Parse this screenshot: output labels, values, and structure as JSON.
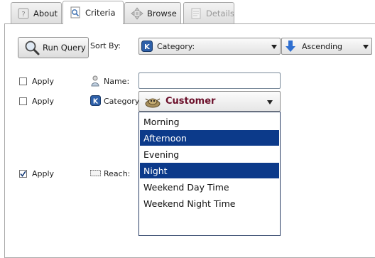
{
  "tabs": [
    {
      "label": "About",
      "icon": "about-icon",
      "state": "normal"
    },
    {
      "label": "Criteria",
      "icon": "criteria-icon",
      "state": "active"
    },
    {
      "label": "Browse",
      "icon": "browse-icon",
      "state": "normal"
    },
    {
      "label": "Details",
      "icon": "details-icon",
      "state": "disabled"
    }
  ],
  "toolbar": {
    "run_query_label": "Run Query",
    "sort_by_label": "Sort By:",
    "sort_field_value": "Category:",
    "sort_order_value": "Ascending"
  },
  "criteria": {
    "name_row": {
      "apply_label": "Apply",
      "apply_checked": false,
      "field_label": "Name:",
      "value": ""
    },
    "category_row": {
      "apply_label": "Apply",
      "apply_checked": false,
      "field_label": "Category:",
      "value": "Customer"
    },
    "reach_row": {
      "apply_label": "Apply",
      "apply_checked": true,
      "field_label": "Reach:"
    }
  },
  "category_dropdown": {
    "options": [
      {
        "label": "Morning",
        "selected": false
      },
      {
        "label": "Afternoon",
        "selected": true
      },
      {
        "label": "Evening",
        "selected": false
      },
      {
        "label": "Night",
        "selected": true
      },
      {
        "label": "Weekend Day Time",
        "selected": false
      },
      {
        "label": "Weekend Night Time",
        "selected": false
      }
    ]
  },
  "colors": {
    "selection": "#0c3a8a",
    "customer_text": "#6b0f2a",
    "sort_icon": "#2f6fd0"
  }
}
